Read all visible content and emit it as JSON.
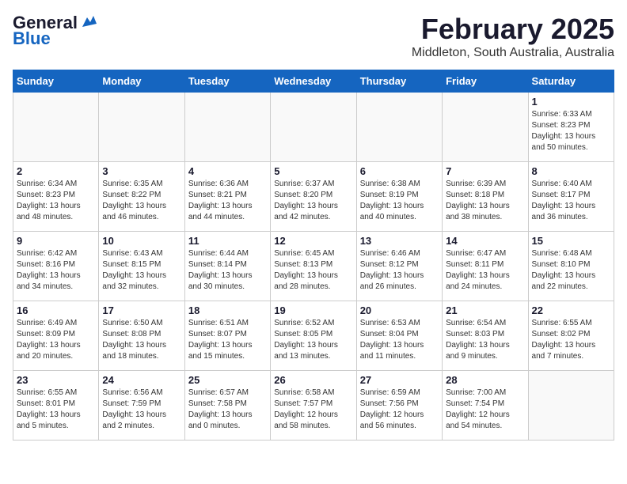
{
  "header": {
    "logo_general": "General",
    "logo_blue": "Blue",
    "title": "February 2025",
    "subtitle": "Middleton, South Australia, Australia"
  },
  "days_of_week": [
    "Sunday",
    "Monday",
    "Tuesday",
    "Wednesday",
    "Thursday",
    "Friday",
    "Saturday"
  ],
  "weeks": [
    [
      {
        "day": "",
        "info": ""
      },
      {
        "day": "",
        "info": ""
      },
      {
        "day": "",
        "info": ""
      },
      {
        "day": "",
        "info": ""
      },
      {
        "day": "",
        "info": ""
      },
      {
        "day": "",
        "info": ""
      },
      {
        "day": "1",
        "info": "Sunrise: 6:33 AM\nSunset: 8:23 PM\nDaylight: 13 hours\nand 50 minutes."
      }
    ],
    [
      {
        "day": "2",
        "info": "Sunrise: 6:34 AM\nSunset: 8:23 PM\nDaylight: 13 hours\nand 48 minutes."
      },
      {
        "day": "3",
        "info": "Sunrise: 6:35 AM\nSunset: 8:22 PM\nDaylight: 13 hours\nand 46 minutes."
      },
      {
        "day": "4",
        "info": "Sunrise: 6:36 AM\nSunset: 8:21 PM\nDaylight: 13 hours\nand 44 minutes."
      },
      {
        "day": "5",
        "info": "Sunrise: 6:37 AM\nSunset: 8:20 PM\nDaylight: 13 hours\nand 42 minutes."
      },
      {
        "day": "6",
        "info": "Sunrise: 6:38 AM\nSunset: 8:19 PM\nDaylight: 13 hours\nand 40 minutes."
      },
      {
        "day": "7",
        "info": "Sunrise: 6:39 AM\nSunset: 8:18 PM\nDaylight: 13 hours\nand 38 minutes."
      },
      {
        "day": "8",
        "info": "Sunrise: 6:40 AM\nSunset: 8:17 PM\nDaylight: 13 hours\nand 36 minutes."
      }
    ],
    [
      {
        "day": "9",
        "info": "Sunrise: 6:42 AM\nSunset: 8:16 PM\nDaylight: 13 hours\nand 34 minutes."
      },
      {
        "day": "10",
        "info": "Sunrise: 6:43 AM\nSunset: 8:15 PM\nDaylight: 13 hours\nand 32 minutes."
      },
      {
        "day": "11",
        "info": "Sunrise: 6:44 AM\nSunset: 8:14 PM\nDaylight: 13 hours\nand 30 minutes."
      },
      {
        "day": "12",
        "info": "Sunrise: 6:45 AM\nSunset: 8:13 PM\nDaylight: 13 hours\nand 28 minutes."
      },
      {
        "day": "13",
        "info": "Sunrise: 6:46 AM\nSunset: 8:12 PM\nDaylight: 13 hours\nand 26 minutes."
      },
      {
        "day": "14",
        "info": "Sunrise: 6:47 AM\nSunset: 8:11 PM\nDaylight: 13 hours\nand 24 minutes."
      },
      {
        "day": "15",
        "info": "Sunrise: 6:48 AM\nSunset: 8:10 PM\nDaylight: 13 hours\nand 22 minutes."
      }
    ],
    [
      {
        "day": "16",
        "info": "Sunrise: 6:49 AM\nSunset: 8:09 PM\nDaylight: 13 hours\nand 20 minutes."
      },
      {
        "day": "17",
        "info": "Sunrise: 6:50 AM\nSunset: 8:08 PM\nDaylight: 13 hours\nand 18 minutes."
      },
      {
        "day": "18",
        "info": "Sunrise: 6:51 AM\nSunset: 8:07 PM\nDaylight: 13 hours\nand 15 minutes."
      },
      {
        "day": "19",
        "info": "Sunrise: 6:52 AM\nSunset: 8:05 PM\nDaylight: 13 hours\nand 13 minutes."
      },
      {
        "day": "20",
        "info": "Sunrise: 6:53 AM\nSunset: 8:04 PM\nDaylight: 13 hours\nand 11 minutes."
      },
      {
        "day": "21",
        "info": "Sunrise: 6:54 AM\nSunset: 8:03 PM\nDaylight: 13 hours\nand 9 minutes."
      },
      {
        "day": "22",
        "info": "Sunrise: 6:55 AM\nSunset: 8:02 PM\nDaylight: 13 hours\nand 7 minutes."
      }
    ],
    [
      {
        "day": "23",
        "info": "Sunrise: 6:55 AM\nSunset: 8:01 PM\nDaylight: 13 hours\nand 5 minutes."
      },
      {
        "day": "24",
        "info": "Sunrise: 6:56 AM\nSunset: 7:59 PM\nDaylight: 13 hours\nand 2 minutes."
      },
      {
        "day": "25",
        "info": "Sunrise: 6:57 AM\nSunset: 7:58 PM\nDaylight: 13 hours\nand 0 minutes."
      },
      {
        "day": "26",
        "info": "Sunrise: 6:58 AM\nSunset: 7:57 PM\nDaylight: 12 hours\nand 58 minutes."
      },
      {
        "day": "27",
        "info": "Sunrise: 6:59 AM\nSunset: 7:56 PM\nDaylight: 12 hours\nand 56 minutes."
      },
      {
        "day": "28",
        "info": "Sunrise: 7:00 AM\nSunset: 7:54 PM\nDaylight: 12 hours\nand 54 minutes."
      },
      {
        "day": "",
        "info": ""
      }
    ]
  ]
}
